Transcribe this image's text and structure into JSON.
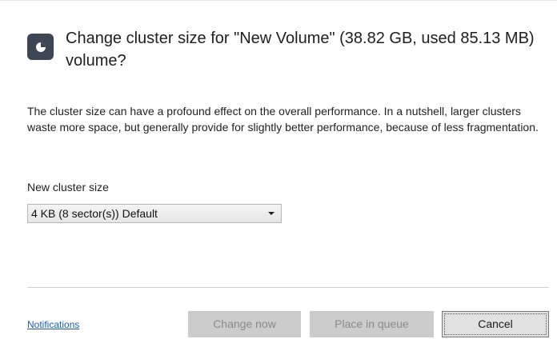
{
  "dialog": {
    "title": "Change cluster size for \"New Volume\" (38.82 GB, used 85.13 MB) volume?",
    "icon": "disk-clock-icon",
    "description": "The cluster size can have a profound effect on the overall performance. In a nutshell, larger clusters waste more space, but generally provide for slightly better performance, because of less fragmentation."
  },
  "cluster_size": {
    "label": "New cluster size",
    "selected": "4 KB (8 sector(s)) Default"
  },
  "footer": {
    "notifications_link": "Notifications",
    "change_now_label": "Change now",
    "place_in_queue_label": "Place in queue",
    "cancel_label": "Cancel"
  },
  "colors": {
    "icon_background": "#3c4654",
    "link": "#1a5fb4",
    "disabled_button": "#cccccc",
    "disabled_text": "#8a8a8a"
  }
}
